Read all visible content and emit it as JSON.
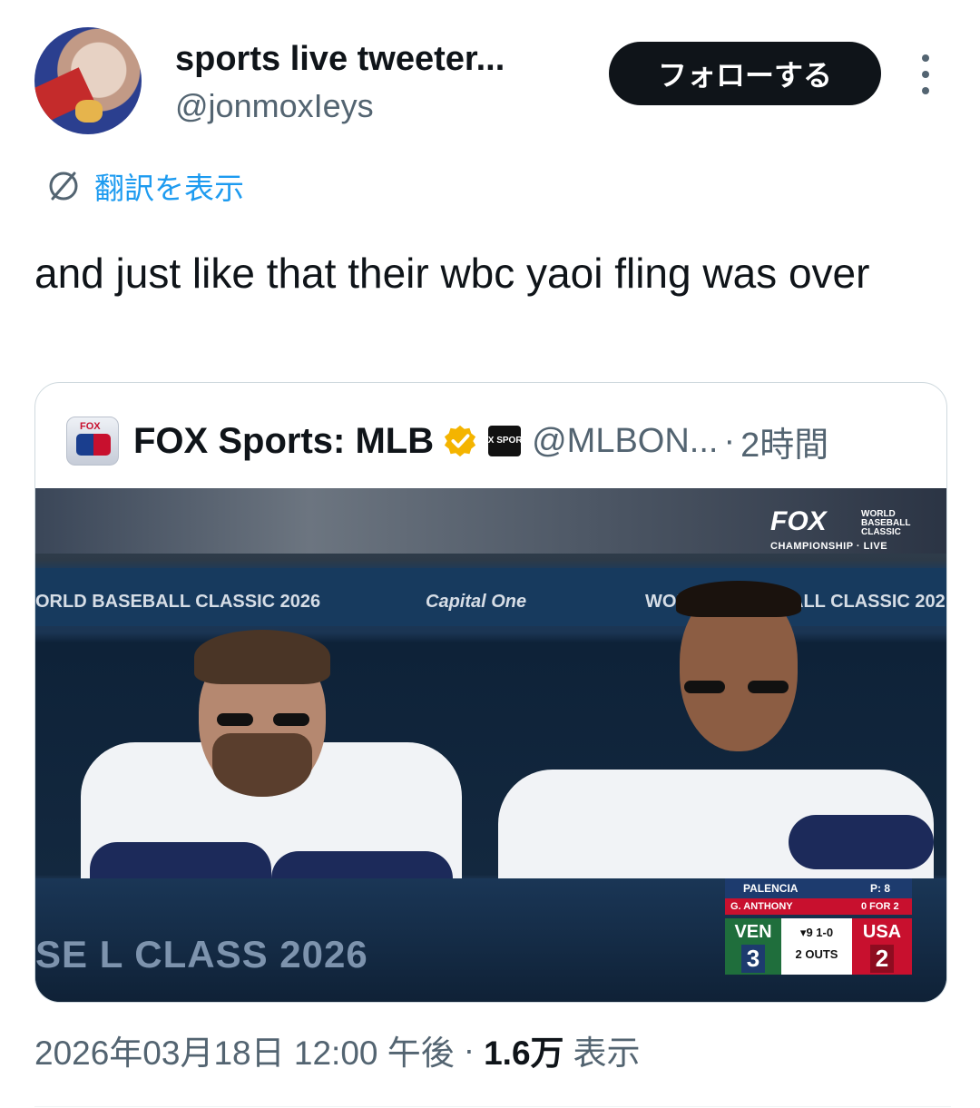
{
  "author": {
    "display_name": "sports live tweeter...",
    "handle": "@jonmoxIeys",
    "avatar_icon": "profile-photo"
  },
  "follow_button": {
    "label": "フォローする"
  },
  "more_icon": "more-vertical-icon",
  "translate": {
    "label": "翻訳を表示",
    "icon": "globe-icon"
  },
  "tweet": {
    "text": "and just like that their wbc yaoi fling was over"
  },
  "quote": {
    "name": "FOX Sports: MLB",
    "verified_color": "#f4b400",
    "handle": "@MLBON...",
    "separator": "·",
    "time": "2時間",
    "badge_text": "FOX SPORTS",
    "logo_text": "FOX",
    "photo": {
      "banner_left": "ORLD BASEBALL CLASSIC 2026",
      "banner_sponsor": "Capital One",
      "banner_right_a": "WOR",
      "banner_right_b": "ALL CLASSIC 202",
      "wall_text": "SE      L CLASS    2026",
      "bug_fox": "FOX",
      "bug_wbc": "WORLD BASEBALL CLASSIC",
      "bug_live": "CHAMPIONSHIP · LIVE",
      "scorebug": {
        "batter": "PALENCIA",
        "batter_stat": "P: 8",
        "pitcher": "G. ANTHONY",
        "pitcher_stat": "0 FOR 2",
        "away_team": "VEN",
        "away_score": "3",
        "home_team": "USA",
        "home_score": "2",
        "inning": "▾9  1-0",
        "outs": "2 OUTS"
      }
    }
  },
  "footer": {
    "timestamp": "2026年03月18日 12:00 午後",
    "separator": "·",
    "views_count": "1.6万",
    "views_label": "表示"
  }
}
